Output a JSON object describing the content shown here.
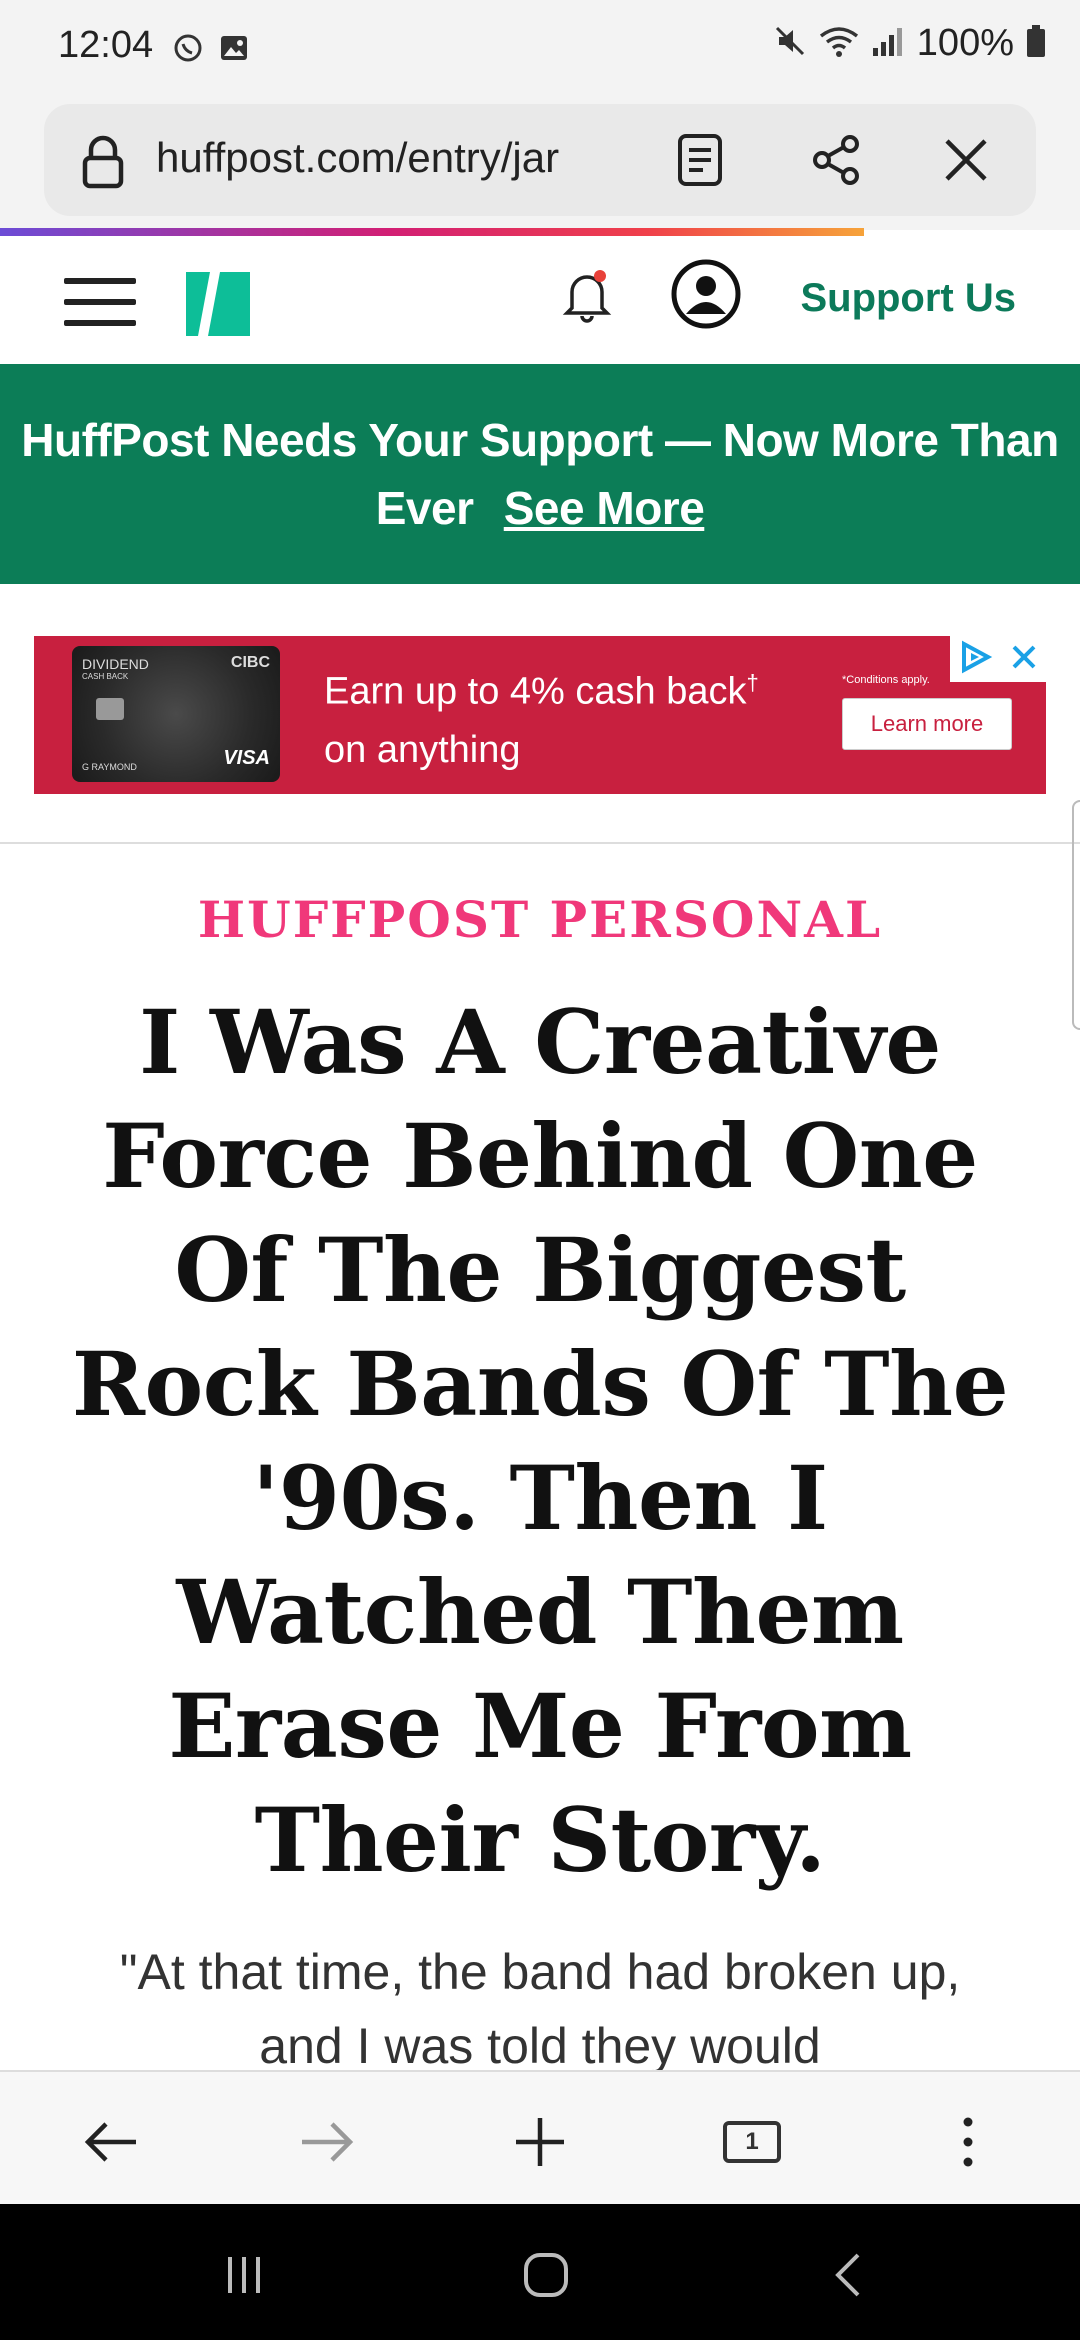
{
  "status_bar": {
    "time": "12:04",
    "battery": "100%",
    "icons": [
      "whatsapp-icon",
      "gallery-icon",
      "mute-icon",
      "wifi-icon",
      "signal-icon",
      "battery-icon"
    ]
  },
  "browser": {
    "url": "huffpost.com/entry/jar",
    "icons": [
      "lock-icon",
      "reader-mode-icon",
      "share-icon",
      "close-icon"
    ],
    "progress_colors": [
      "#6c4cd6",
      "#d21f74",
      "#f6a33a"
    ]
  },
  "site_header": {
    "support_label": "Support Us",
    "logo_color": "#0dbe98",
    "icons": [
      "menu-icon",
      "notification-bell-icon",
      "account-icon"
    ]
  },
  "banner": {
    "text": "HuffPost Needs Your Support — Now More Than Ever",
    "link": "See More",
    "color": "#0c7d57"
  },
  "ad": {
    "card_brand": "CIBC",
    "card_name": "DIVIDEND",
    "card_sub": "CASH BACK",
    "card_holder": "G RAYMOND",
    "card_network": "VISA",
    "headline_line1": "Earn up to 4% cash back",
    "dagger": "†",
    "headline_line2": "on anything",
    "conditions": "*Conditions apply.",
    "cta": "Learn more",
    "color": "#c8203f"
  },
  "article": {
    "kicker": "HUFFPOST PERSONAL",
    "kicker_color": "#f0387a",
    "headline": "I Was A Creative Force Behind One Of The Biggest Rock Bands Of The '90s. Then I Watched Them Erase Me From Their Story.",
    "dek": "\"At that time, the band had broken up, and I was told they would"
  },
  "browser_nav": {
    "tab_count": "1",
    "icons": [
      "back-icon",
      "forward-icon",
      "new-tab-icon",
      "tabs-icon",
      "more-icon"
    ]
  },
  "system_nav": {
    "icons": [
      "recent-apps-icon",
      "home-icon",
      "system-back-icon"
    ]
  }
}
